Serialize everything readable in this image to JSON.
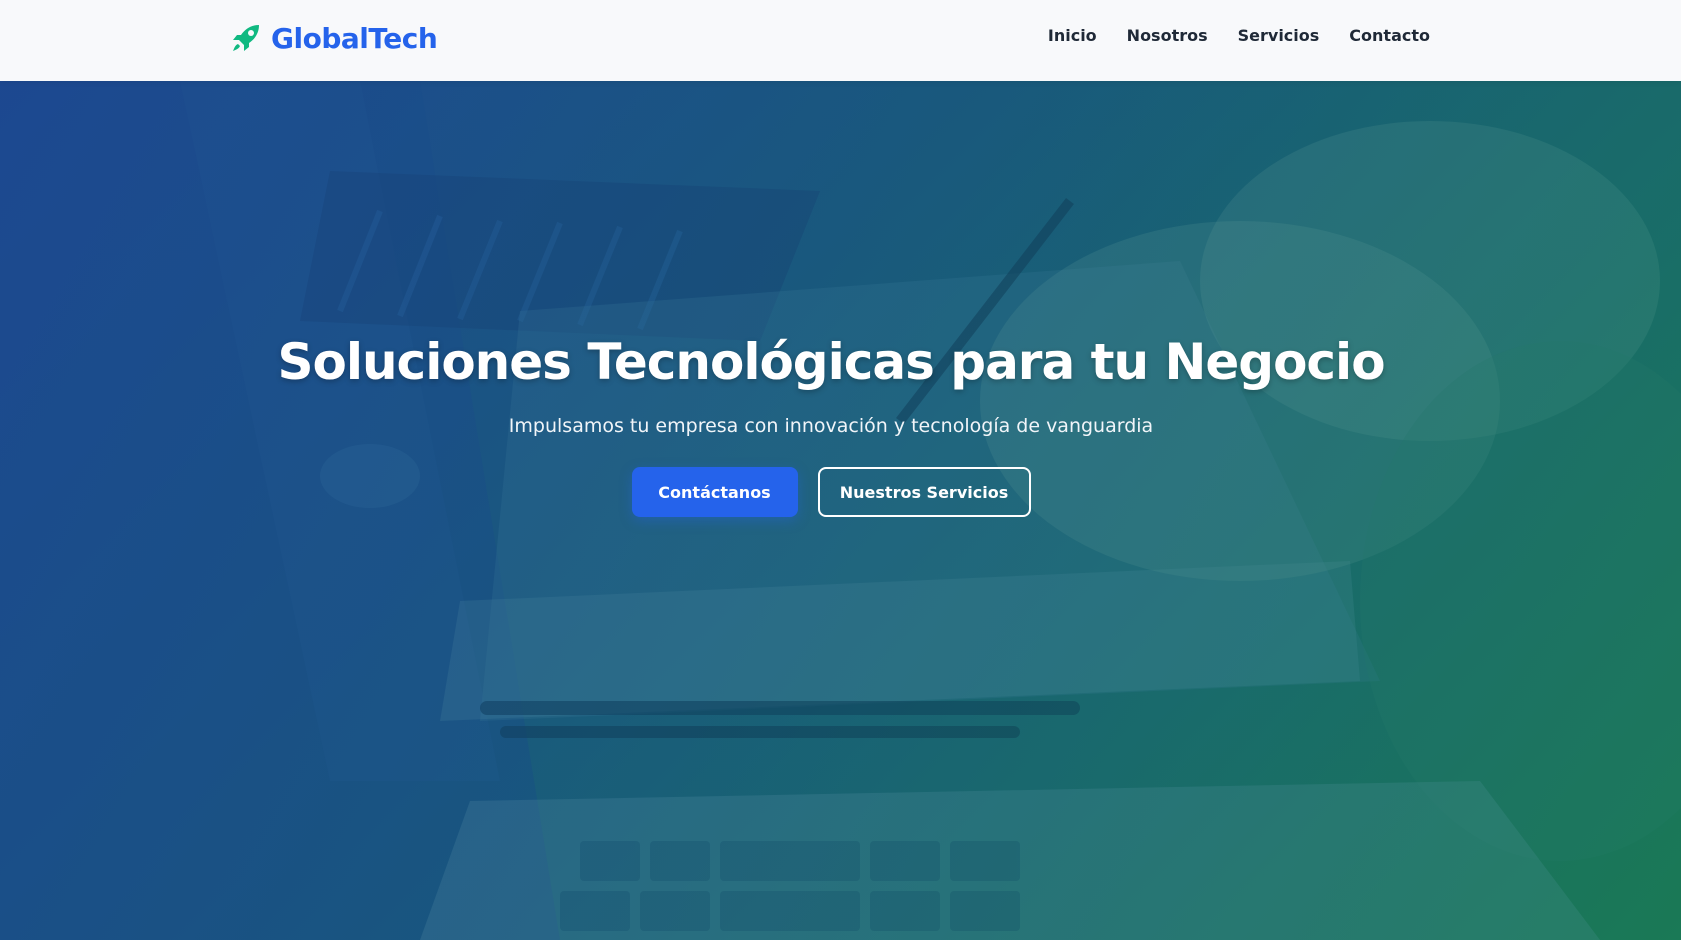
{
  "brand": {
    "name": "GlobalTech",
    "logo_icon": "rocket-icon",
    "text_color": "#2563eb",
    "icon_color": "#10b981"
  },
  "nav": {
    "items": [
      {
        "label": "Inicio"
      },
      {
        "label": "Nosotros"
      },
      {
        "label": "Servicios"
      },
      {
        "label": "Contacto"
      }
    ]
  },
  "hero": {
    "title": "Soluciones Tecnológicas para tu Negocio",
    "subtitle": "Impulsamos tu empresa con innovación y tecnología de vanguardia",
    "primary_button": "Contáctanos",
    "secondary_button": "Nuestros Servicios",
    "background_description_icon": "office-desk-photo",
    "colors": {
      "primary_button": "#2563eb",
      "gradient_start": "#1d4b8f",
      "gradient_end": "#1f7a5a"
    }
  }
}
